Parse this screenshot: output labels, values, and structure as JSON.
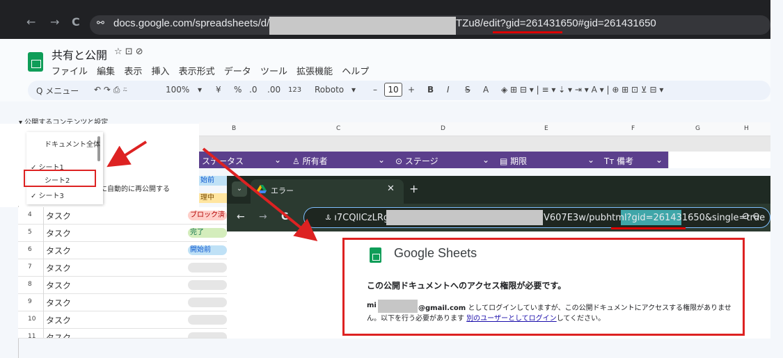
{
  "browser": {
    "url_left": "docs.google.com/spreadsheets/d/1fefU",
    "url_right": "TZu8/edit?gid=261431650#gid=261431650",
    "back": "←",
    "forward": "→",
    "reload": "C",
    "site_settings": "⚯"
  },
  "sheets": {
    "title": "共有と公開",
    "title_icons": "☆  ⊡  ⊘",
    "menu": [
      "ファイル",
      "編集",
      "表示",
      "挿入",
      "表示形式",
      "データ",
      "ツール",
      "拡張機能",
      "ヘルプ"
    ],
    "toolbar": {
      "menu_search": "Q メニュー",
      "undo_redo": "↶ ↷ ⎙ ⍨",
      "zoom": "100%",
      "zoom_caret": "▾",
      "currency": "¥",
      "percent": "%",
      "dec_less": ".0",
      "dec_more": ".00",
      "format_123": "123",
      "font": "Roboto",
      "font_caret": "▾",
      "minus": "–",
      "font_size": "10",
      "plus": "+",
      "bold": "B",
      "italic": "I",
      "strike": "S̶",
      "text_a": "A",
      "rest": "◈  ⊞  ⊟ ▾  |  ≡ ▾  ⇣ ▾  ⇥ ▾  A ▾  |  ⊕  ⊞  ⊡  ⊻  ⊟ ▾"
    }
  },
  "panel": {
    "header": "▾ 公開するコンテンツと設定",
    "dropdown": [
      "ドキュメント全体",
      "✓ シート1",
      "シート2",
      "✓ シート3"
    ],
    "republish": "に自動的に再公開する"
  },
  "grid": {
    "columns": [
      "B",
      "C",
      "D",
      "E",
      "F",
      "G",
      "H"
    ],
    "header_cells": [
      "ステータス",
      "⌄",
      "♙ 所有者",
      "⌄",
      "⊙ ステージ",
      "⌄",
      "▤ 期限",
      "⌄",
      "Tт 備考",
      "⌄"
    ],
    "top_chips": [
      "始前",
      "理中"
    ],
    "rows": [
      {
        "num": "4",
        "task": "タスク",
        "chip": "ブロック済"
      },
      {
        "num": "5",
        "task": "タスク",
        "chip": "完了"
      },
      {
        "num": "6",
        "task": "タスク",
        "chip": "開始前"
      },
      {
        "num": "7",
        "task": "タスク",
        "chip": ""
      },
      {
        "num": "8",
        "task": "タスク",
        "chip": ""
      },
      {
        "num": "9",
        "task": "タスク",
        "chip": ""
      },
      {
        "num": "10",
        "task": "タスク",
        "chip": ""
      },
      {
        "num": "11",
        "task": "タスク",
        "chip": ""
      }
    ]
  },
  "popup": {
    "tab_title": "エラー",
    "tab_close": "✕",
    "new_tab": "+",
    "menu_btn": "⌄",
    "url_left": "ꕊ  ı7CQllCzLRgmz",
    "url_right_a": "V607E3w/pubhtml?",
    "url_gid": "gid=261431650",
    "url_right_b": "&single=true",
    "lens": "⊙  ⊖",
    "back": "←",
    "forward": "→",
    "reload": "C",
    "product": "Google Sheets",
    "heading": "この公開ドキュメントへのアクセス権限が必要です。",
    "mi": "mi",
    "email_domain": "@gmail.com",
    "line1_rest": " としてログインしていますが、この公開ドキュメントにアクセスする権限がありませ",
    "line2_a": "ん。以下を行う必要があります ",
    "line2_link": "別のユーザーとしてログイン",
    "line2_b": "してください。"
  },
  "colors": {
    "accent_red": "#dd2222",
    "header_purple": "#5b3f8c",
    "sheets_green": "#0f9d58"
  }
}
